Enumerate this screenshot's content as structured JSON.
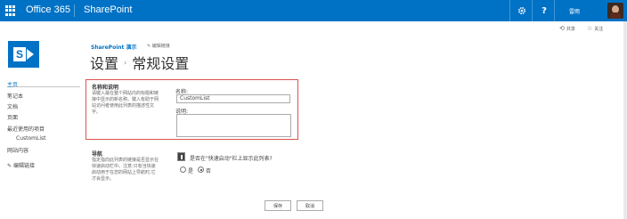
{
  "suite_bar": {
    "brand": "Office 365",
    "app_name": "SharePoint",
    "settings_icon": "gear-icon",
    "help_icon": "question-icon",
    "help_label": "?",
    "user_name": "雷雨",
    "accent": "#0072c6"
  },
  "actions": {
    "share_label": "共享",
    "follow_label": "关注"
  },
  "site": {
    "title": "SharePoint 演示",
    "edit_links_label": "编辑链接"
  },
  "page": {
    "breadcrumb_parent": "设置",
    "breadcrumb_separator": "›",
    "title": "常规设置"
  },
  "left_nav": {
    "items": [
      {
        "label": "主页"
      },
      {
        "label": "笔记本"
      },
      {
        "label": "文档"
      },
      {
        "label": "页面"
      },
      {
        "label": "最近使用的项目"
      },
      {
        "label": "CustomList"
      },
      {
        "label": "网站内容"
      }
    ],
    "edit_links_label": "编辑链接"
  },
  "name_section": {
    "heading": "名称和说明",
    "description": "请键入最在整个网站内的标题和链接中显示的新名称。键入有助于网站访问者使用此列表的描述性文字。",
    "name_label": "名称:",
    "name_value": "CustomList",
    "desc_label": "说明:",
    "highlight_color": "#d9534f"
  },
  "nav_section": {
    "heading": "导航",
    "description": "指定指向此列表的链接是否显示在快速启动栏中。注意:只有当快速启动用于在您的网站上导航时,它才会显示。",
    "question": "是否在\"快速启动\"栏上显示此列表?",
    "option_yes": "是",
    "option_no": "否",
    "selected": "否"
  },
  "buttons": {
    "save": "保存",
    "cancel": "取消"
  }
}
